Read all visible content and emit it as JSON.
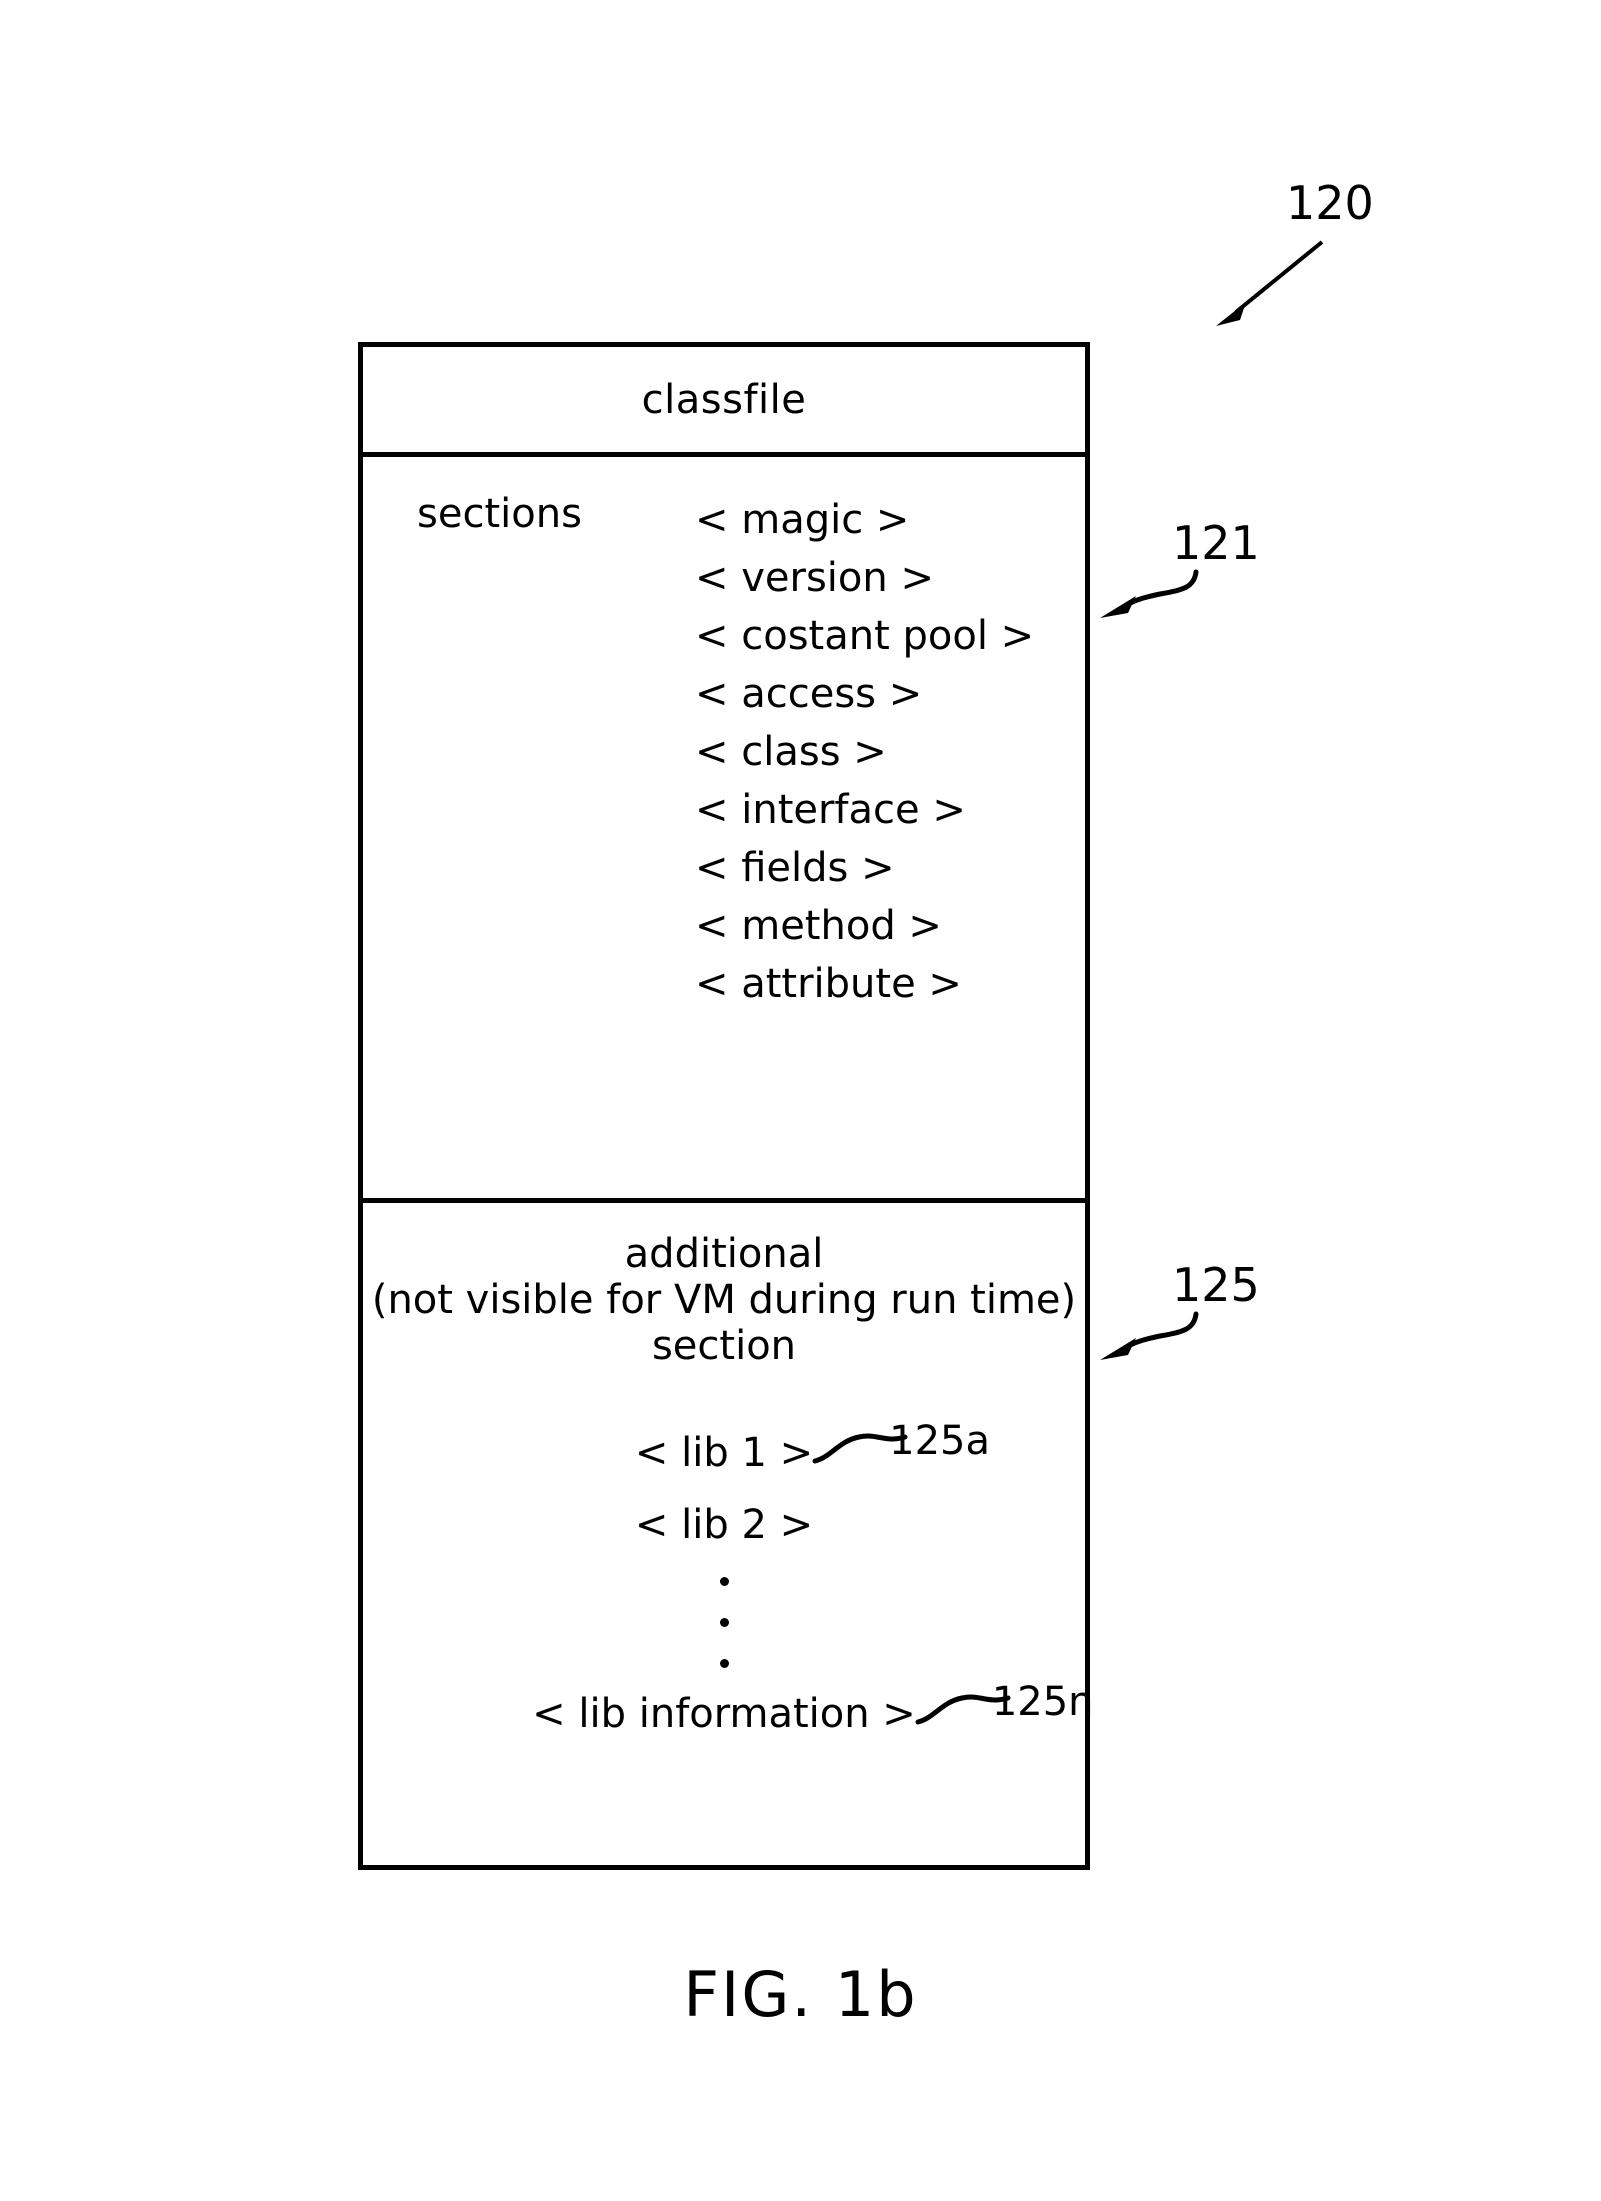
{
  "figure": {
    "caption": "FIG. 1b",
    "overall_ref": "120"
  },
  "classfile": {
    "title": "classfile",
    "sections_band": {
      "ref": "121",
      "label": "sections",
      "items": [
        "< magic >",
        "< version >",
        "< costant pool >",
        "< access >",
        "< class >",
        "< interface >",
        "< fields >",
        "< method >",
        "< attribute >"
      ]
    },
    "additional_band": {
      "ref": "125",
      "heading_lines": [
        "additional",
        "(not visible for VM during run time)",
        "section"
      ],
      "entries": [
        {
          "text": "< lib 1 >",
          "ref": "125a"
        },
        {
          "text": "< lib 2 >",
          "ref": ""
        }
      ],
      "ellipsis": "vertical-ellipsis",
      "last_entry": {
        "text": "< lib information >",
        "ref": "125n"
      }
    }
  },
  "colors": {
    "ink": "#000000",
    "paper": "#ffffff"
  }
}
